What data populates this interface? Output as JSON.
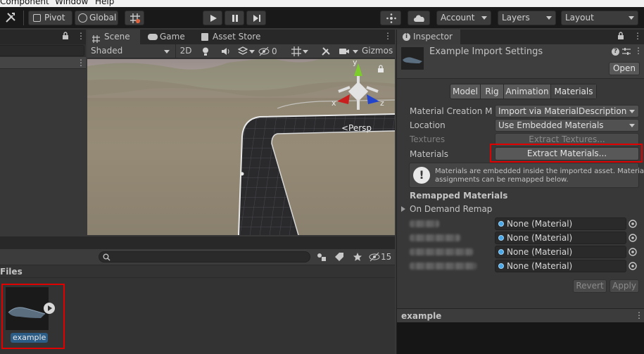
{
  "menubar": {
    "items": [
      "Component",
      "Window",
      "Help"
    ]
  },
  "toolbar": {
    "pivot_label": "Pivot",
    "global_label": "Global",
    "account_label": "Account",
    "layers_label": "Layers",
    "layout_label": "Layout"
  },
  "scene": {
    "tabs": [
      "Scene",
      "Game",
      "Asset Store"
    ],
    "shading_mode": "Shaded",
    "mode_2d": "2D",
    "hidden_count": "0",
    "gizmos_label": "Gizmos",
    "persp_label": "<Persp",
    "axis_labels": {
      "x": "x",
      "y": "y",
      "z": "z"
    }
  },
  "project": {
    "files_header": "Files",
    "badge_count": "15",
    "asset_name": "example"
  },
  "inspector": {
    "tab_title": "Inspector",
    "asset_title": "Example Import Settings",
    "open_button": "Open",
    "tabs": [
      "Model",
      "Rig",
      "Animation",
      "Materials"
    ],
    "active_tab": "Materials",
    "rows": {
      "material_creation_label": "Material Creation Mo",
      "material_creation_value": "Import via MaterialDescription",
      "location_label": "Location",
      "location_value": "Use Embedded Materials",
      "textures_label": "Textures",
      "extract_textures_button": "Extract Textures...",
      "materials_label": "Materials",
      "extract_materials_button": "Extract Materials..."
    },
    "info_message_line1": "Materials are embedded inside the imported asset. Material",
    "info_message_line2": "assignments can be remapped below.",
    "remapped_header": "Remapped Materials",
    "on_demand_remap": "On Demand Remap",
    "remap_values": [
      "None (Material)",
      "None (Material)",
      "None (Material)",
      "None (Material)"
    ],
    "revert_button": "Revert",
    "apply_button": "Apply",
    "preview_title": "example"
  },
  "colors": {
    "highlight_red": "#e00000",
    "accent_blue": "#4aa8e8",
    "axis_x": "#cc2222",
    "axis_y": "#66cc22",
    "axis_z": "#2244cc"
  }
}
